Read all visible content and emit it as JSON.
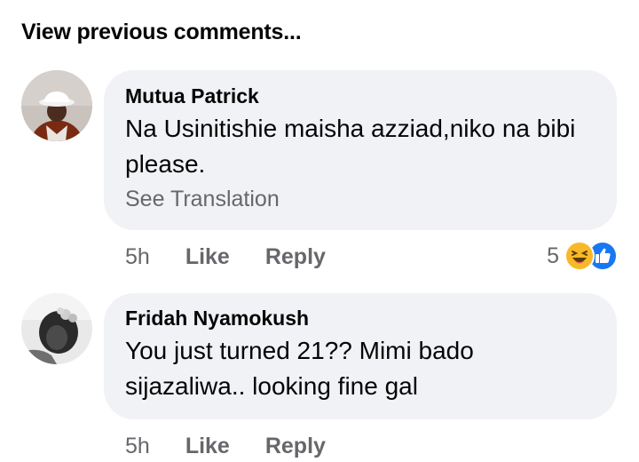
{
  "view_previous_label": "View previous comments...",
  "comments": [
    {
      "author": "Mutua Patrick",
      "text": "Na Usinitishie maisha azziad,niko na bibi please.",
      "translation_link": "See Translation",
      "time": "5h",
      "like_label": "Like",
      "reply_label": "Reply",
      "reaction_count": "5",
      "reactions": [
        "haha-icon",
        "like-icon"
      ]
    },
    {
      "author": "Fridah Nyamokush",
      "text": "You just turned 21?? Mimi bado sijazaliwa.. looking fine gal",
      "time": "5h",
      "like_label": "Like",
      "reply_label": "Reply"
    }
  ],
  "colors": {
    "bubble_bg": "#f0f2f5",
    "secondary_text": "#65676b",
    "primary_text": "#050505",
    "like_blue": "#1877f2",
    "haha_yellow": "#f7b928"
  }
}
